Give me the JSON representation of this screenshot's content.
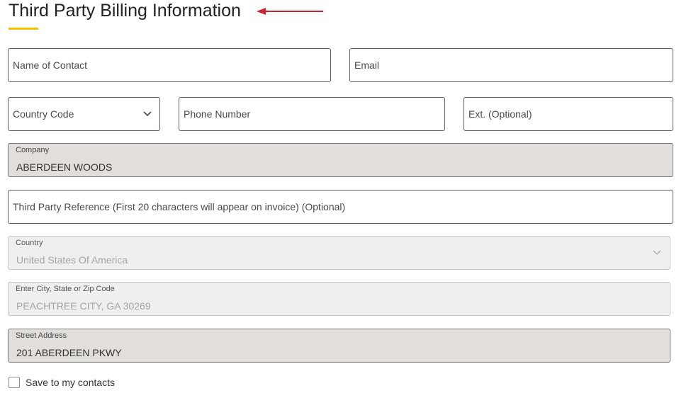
{
  "header": {
    "title": "Third Party Billing Information"
  },
  "colors": {
    "accent_underline": "#f2c200",
    "annotation_arrow": "#d4202a"
  },
  "fields": {
    "name_of_contact": {
      "placeholder": "Name of Contact"
    },
    "email": {
      "placeholder": "Email"
    },
    "country_code": {
      "placeholder": "Country Code",
      "icon": "chevron-down-icon"
    },
    "phone_number": {
      "placeholder": "Phone Number"
    },
    "ext": {
      "placeholder": "Ext. (Optional)"
    },
    "company": {
      "label": "Company",
      "value": "ABERDEEN WOODS"
    },
    "third_party_reference": {
      "placeholder": "Third Party Reference (First 20 characters will appear on invoice) (Optional)"
    },
    "country": {
      "label": "Country",
      "value": "United States Of America",
      "icon": "chevron-down-icon"
    },
    "city_state_zip": {
      "label": "Enter City, State or Zip Code",
      "value": "PEACHTREE CITY, GA 30269"
    },
    "street_address": {
      "label": "Street Address",
      "value": "201 ABERDEEN PKWY"
    }
  },
  "save_contacts": {
    "label": "Save to my contacts",
    "checked": false
  }
}
